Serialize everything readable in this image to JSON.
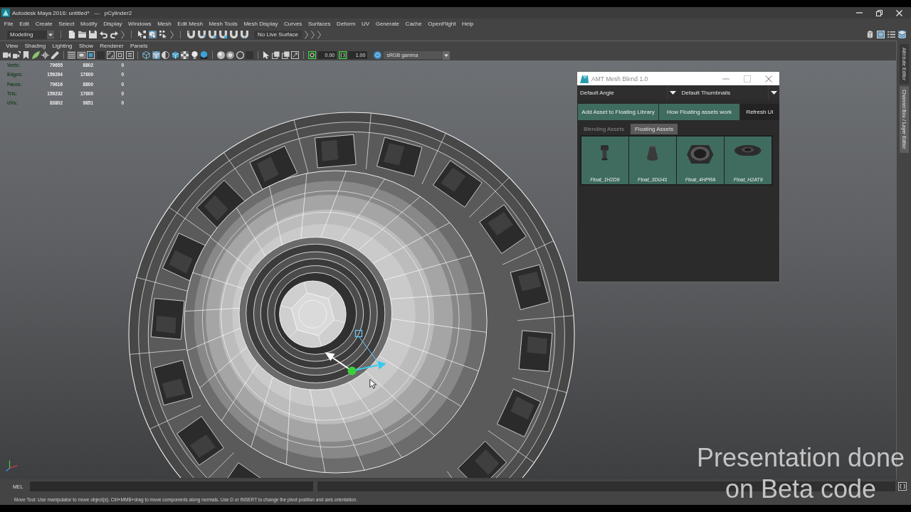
{
  "window": {
    "title": "Autodesk Maya 2016: untitled*   ---   pCylinder2"
  },
  "menu_bar": [
    "File",
    "Edit",
    "Create",
    "Select",
    "Modify",
    "Display",
    "Windows",
    "Mesh",
    "Edit Mesh",
    "Mesh Tools",
    "Mesh Display",
    "Curves",
    "Surfaces",
    "Deform",
    "UV",
    "Generate",
    "Cache",
    "OpenFlight",
    "Help"
  ],
  "status_line": {
    "menu_set": "Modeling",
    "select_modes": [
      {
        "on": false
      },
      {
        "on": true
      },
      {
        "on": false
      }
    ],
    "live_surface": "No Live Surface",
    "workspace_toggles": [
      {
        "on": false
      },
      {
        "on": true
      },
      {
        "on": false
      },
      {
        "on": true
      }
    ]
  },
  "panel": {
    "menu": [
      "View",
      "Shading",
      "Lighting",
      "Show",
      "Renderer",
      "Panels"
    ],
    "shading_modes": [
      {
        "on": false
      },
      {
        "on": true
      }
    ],
    "exposure": "0.00",
    "gamma": "1.00",
    "view_transform": "sRGB gamma"
  },
  "hud_stats": [
    {
      "label": "Verts:",
      "values": [
        "79655",
        "8802",
        "0"
      ]
    },
    {
      "label": "Edges:",
      "values": [
        "159264",
        "17600",
        "0"
      ]
    },
    {
      "label": "Faces:",
      "values": [
        "79616",
        "8800",
        "0"
      ]
    },
    {
      "label": "Tris:",
      "values": [
        "159232",
        "17600",
        "0"
      ]
    },
    {
      "label": "UVs:",
      "values": [
        "83802",
        "9851",
        "0"
      ]
    }
  ],
  "side_tabs": [
    {
      "label": "Attribute Editor",
      "selected": false
    },
    {
      "label": "Channel Box / Layer Editor",
      "selected": true
    }
  ],
  "plugin_window": {
    "title": "AMT Mesh Blend 1.0",
    "dropdowns": [
      "Default Angle",
      "Default Thumbnails"
    ],
    "buttons": [
      {
        "label": "Add Asset to Floating Library",
        "kind": "accent"
      },
      {
        "label": "How Floating assets work",
        "kind": "accent"
      },
      {
        "label": "Refresh UI",
        "kind": "plain"
      }
    ],
    "tabs": [
      {
        "label": "Blending Assets",
        "selected": false
      },
      {
        "label": "Floating Assets",
        "selected": true
      }
    ],
    "assets": [
      {
        "label": "Float_1H2D9"
      },
      {
        "label": "Float_3DG41"
      },
      {
        "label": "Float_4HPRA"
      },
      {
        "label": "Float_H2AT9"
      }
    ]
  },
  "command_line": {
    "language": "MEL"
  },
  "help_line": "Move Tool: Use manipulator to move object(s). Ctrl+MMB+drag to move components along normals. Use D or INSERT to change the pivot position and axis orientation.",
  "caption": [
    "Presentation done",
    "on Beta code"
  ]
}
